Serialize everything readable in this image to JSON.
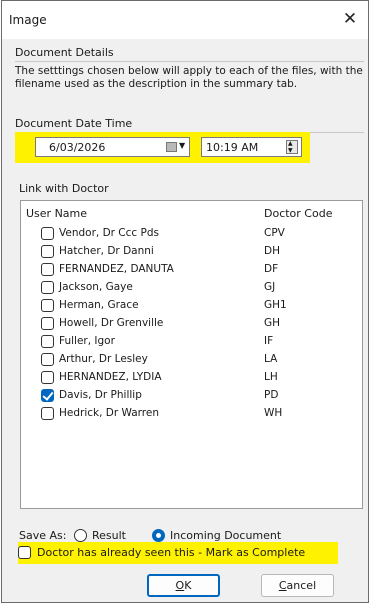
{
  "window": {
    "title": "Image",
    "close_glyph": "✕"
  },
  "document_details": {
    "group_label": "Document Details",
    "description": "The setttings chosen below will apply to each of the files, with the filename used as the description in the summary tab."
  },
  "document_date_time": {
    "group_label": "Document Date Time",
    "date": "6/03/2026",
    "time": "10:19 AM"
  },
  "link_with_doctor": {
    "group_label": "Link with Doctor",
    "columns": {
      "user": "User Name",
      "code": "Doctor Code"
    },
    "rows": [
      {
        "name": "Vendor, Dr Ccc Pds",
        "code": "CPV",
        "checked": false
      },
      {
        "name": "Hatcher, Dr Danni",
        "code": "DH",
        "checked": false
      },
      {
        "name": "FERNANDEZ,  DANUTA",
        "code": "DF",
        "checked": false
      },
      {
        "name": "Jackson,  Gaye",
        "code": "GJ",
        "checked": false
      },
      {
        "name": "Herman,  Grace",
        "code": "GH1",
        "checked": false
      },
      {
        "name": "Howell, Dr Grenville",
        "code": "GH",
        "checked": false
      },
      {
        "name": "Fuller,  Igor",
        "code": "IF",
        "checked": false
      },
      {
        "name": "Arthur, Dr Lesley",
        "code": "LA",
        "checked": false
      },
      {
        "name": "HERNANDEZ,  LYDIA",
        "code": "LH",
        "checked": false
      },
      {
        "name": "Davis, Dr Phillip",
        "code": "PD",
        "checked": true
      },
      {
        "name": "Hedrick, Dr Warren",
        "code": "WH",
        "checked": false
      }
    ]
  },
  "save_as": {
    "label": "Save As:",
    "options": [
      {
        "label": "Result",
        "selected": false
      },
      {
        "label": "Incoming Document",
        "selected": true
      }
    ]
  },
  "mark_complete": {
    "label": "Doctor has already seen this - Mark as Complete",
    "checked": false
  },
  "buttons": {
    "ok": {
      "mnemonic": "O",
      "rest": "K"
    },
    "cancel": {
      "mnemonic": "C",
      "rest": "ancel"
    }
  },
  "colors": {
    "highlight": "#fff200",
    "accent": "#0067c0"
  }
}
